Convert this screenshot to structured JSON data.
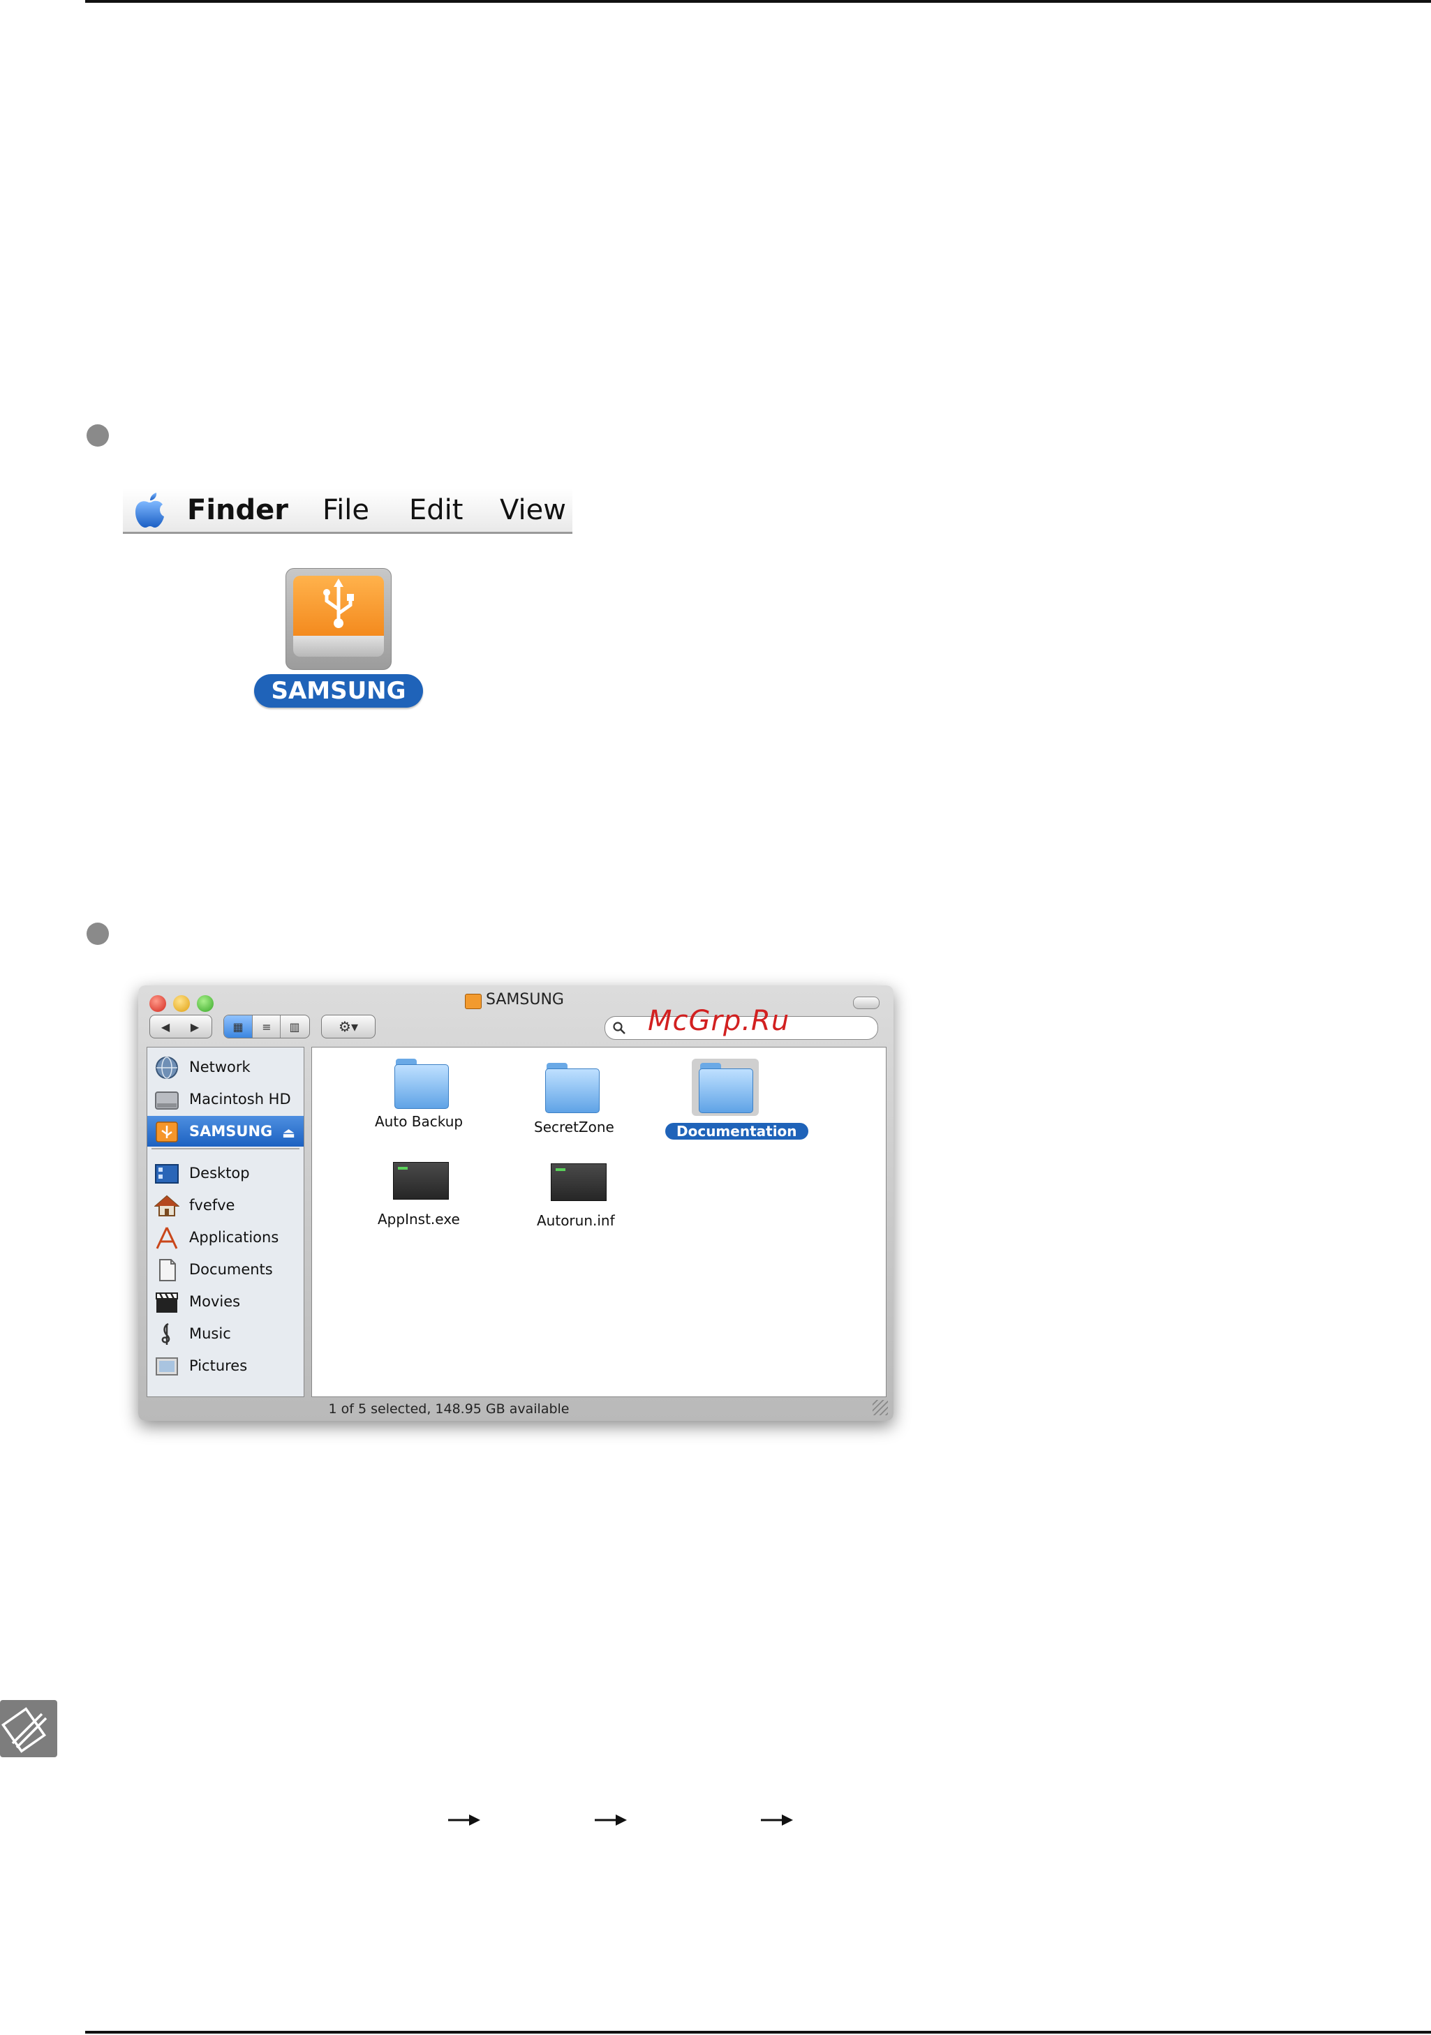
{
  "menubar": {
    "items": [
      {
        "label": "Finder",
        "bold": true
      },
      {
        "label": "File",
        "bold": false
      },
      {
        "label": "Edit",
        "bold": false
      },
      {
        "label": "View",
        "bold": false
      }
    ]
  },
  "desktop_icon": {
    "label": "SAMSUNG",
    "icon": "usb-drive-icon",
    "color": "#F28C1E"
  },
  "window": {
    "title": "SAMSUNG",
    "watermark": "McGrp.Ru",
    "sidebar": {
      "devices": [
        {
          "label": "Network",
          "icon": "network-globe-icon"
        },
        {
          "label": "Macintosh HD",
          "icon": "hard-drive-icon"
        },
        {
          "label": "SAMSUNG",
          "icon": "usb-drive-icon",
          "selected": true
        }
      ],
      "places": [
        {
          "label": "Desktop",
          "icon": "desktop-icon"
        },
        {
          "label": "fvefve",
          "icon": "home-icon"
        },
        {
          "label": "Applications",
          "icon": "applications-icon"
        },
        {
          "label": "Documents",
          "icon": "documents-icon"
        },
        {
          "label": "Movies",
          "icon": "movies-clapper-icon"
        },
        {
          "label": "Music",
          "icon": "music-clef-icon"
        },
        {
          "label": "Pictures",
          "icon": "pictures-icon"
        }
      ]
    },
    "files": [
      {
        "name": "Auto Backup",
        "kind": "folder",
        "selected": false
      },
      {
        "name": "SecretZone",
        "kind": "folder",
        "selected": false
      },
      {
        "name": "Documentation",
        "kind": "folder",
        "selected": true
      },
      {
        "name": "AppInst.exe",
        "kind": "executable",
        "selected": false
      },
      {
        "name": "Autorun.inf",
        "kind": "executable",
        "selected": false
      }
    ],
    "status": "1 of 5 selected, 148.95 GB available"
  },
  "colors": {
    "selection": "#1F63B9",
    "bullet": "#8A8A8A",
    "watermark": "#D22020"
  }
}
